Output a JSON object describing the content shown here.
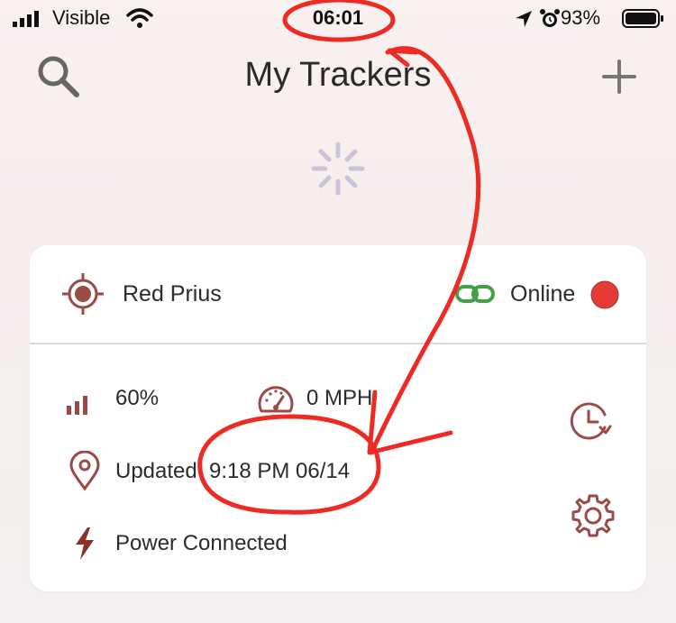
{
  "status_bar": {
    "carrier": "Visible",
    "time": "06:01",
    "battery": "93%",
    "icons": [
      "signal-bars-icon",
      "wifi-icon",
      "location-arrow-icon",
      "alarm-icon",
      "battery-icon"
    ]
  },
  "header": {
    "title": "My Trackers",
    "left_icon": "search-icon",
    "right_icon": "plus-icon"
  },
  "loading": {
    "icon": "spinner-icon"
  },
  "tracker": {
    "name": "Red Prius",
    "status": "Online",
    "status_color": "#e53935",
    "accent_color": "#9b4a45",
    "link_color": "#43a047",
    "signal": "60%",
    "speed": "0 MPH",
    "updated_label": "Updated",
    "updated_time": "9:18 PM 06/14",
    "power": "Power Connected",
    "actions": [
      "history-icon",
      "settings-gear-icon"
    ]
  },
  "annotation": {
    "color": "#ee2a24",
    "description_marks": [
      "circle-time",
      "arrow",
      "circle-updated"
    ]
  }
}
